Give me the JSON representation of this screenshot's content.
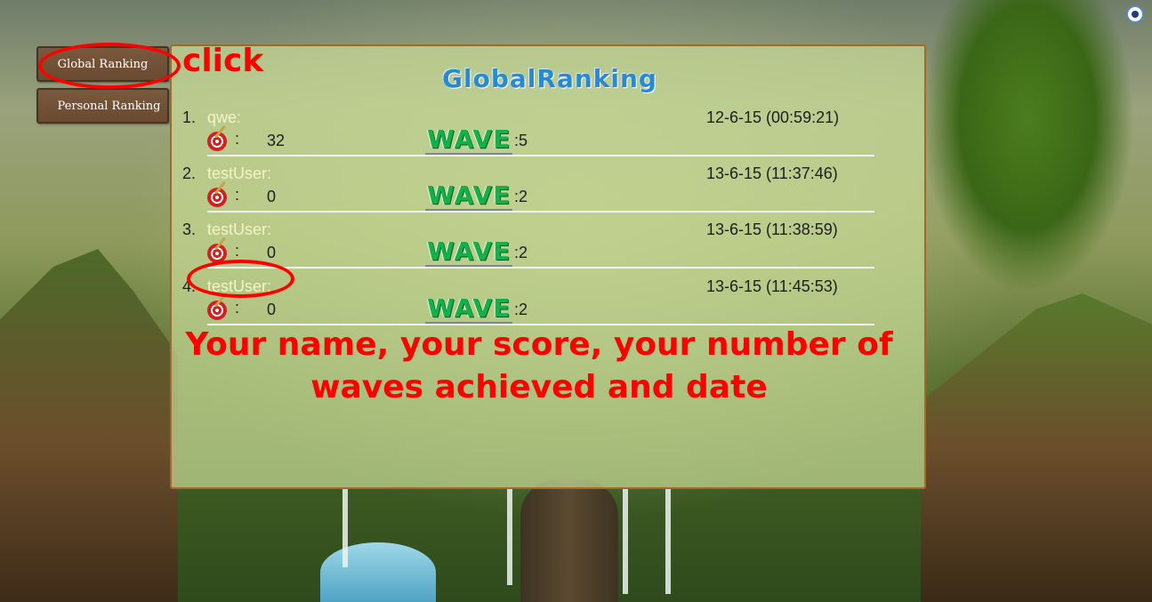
{
  "menu": {
    "global_ranking": "Global Ranking",
    "personal_ranking": "Personal Ranking"
  },
  "panel": {
    "title": "GlobalRanking",
    "entries": [
      {
        "rank": "1.",
        "name": "qwe:",
        "score": "32",
        "waves": ":5",
        "date": "12-6-15 (00:59:21)"
      },
      {
        "rank": "2.",
        "name": "testUser:",
        "score": "0",
        "waves": ":2",
        "date": "13-6-15 (11:37:46)"
      },
      {
        "rank": "3.",
        "name": "testUser:",
        "score": "0",
        "waves": ":2",
        "date": "13-6-15 (11:38:59)"
      },
      {
        "rank": "4.",
        "name": "testUser:",
        "score": "0",
        "waves": ":2",
        "date": "13-6-15 (11:45:53)"
      }
    ],
    "wave_label": "WAVE",
    "score_colon": ":"
  },
  "annotations": {
    "click": "click",
    "caption_line1": "Your name, your score, your number of",
    "caption_line2": "waves achieved and date"
  },
  "icons": {
    "score": "target-dart-icon",
    "settings": "settings-circle-icon"
  },
  "colors": {
    "annotation": "#ff0000",
    "title": "#2a8ad0",
    "wave": "#14b04a",
    "button": "#6a4a30",
    "panel_border": "#a06a2a"
  }
}
